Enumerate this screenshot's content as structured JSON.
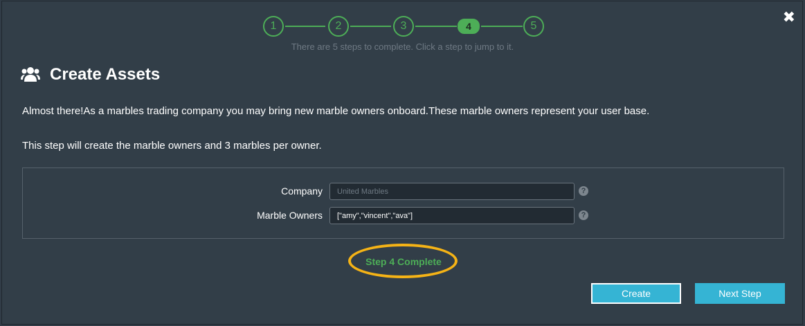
{
  "stepper": {
    "steps": [
      "1",
      "2",
      "3",
      "4",
      "5"
    ],
    "active_step": 4,
    "hint": "There are 5 steps to complete. Click a step to jump to it."
  },
  "close_icon": "close-icon",
  "title": {
    "icon": "users-icon",
    "text": "Create Assets"
  },
  "description": {
    "line1": "Almost there!As a marbles trading company you may bring new marble owners onboard.These marble owners represent your user base.",
    "line2": "This step will create the marble owners and 3 marbles per owner."
  },
  "form": {
    "company": {
      "label": "Company",
      "value": "United Marbles"
    },
    "owners": {
      "label": "Marble Owners",
      "value": "[\"amy\",\"vincent\",\"ava\"]"
    },
    "help_glyph": "?"
  },
  "status": {
    "text": "Step 4 Complete",
    "color": "#4dae57",
    "highlight_color": "#f5b316"
  },
  "buttons": {
    "create": "Create",
    "next": "Next Step"
  },
  "colors": {
    "background": "#323e48",
    "accent_green": "#4dae57",
    "button_blue": "#35b4d4"
  }
}
